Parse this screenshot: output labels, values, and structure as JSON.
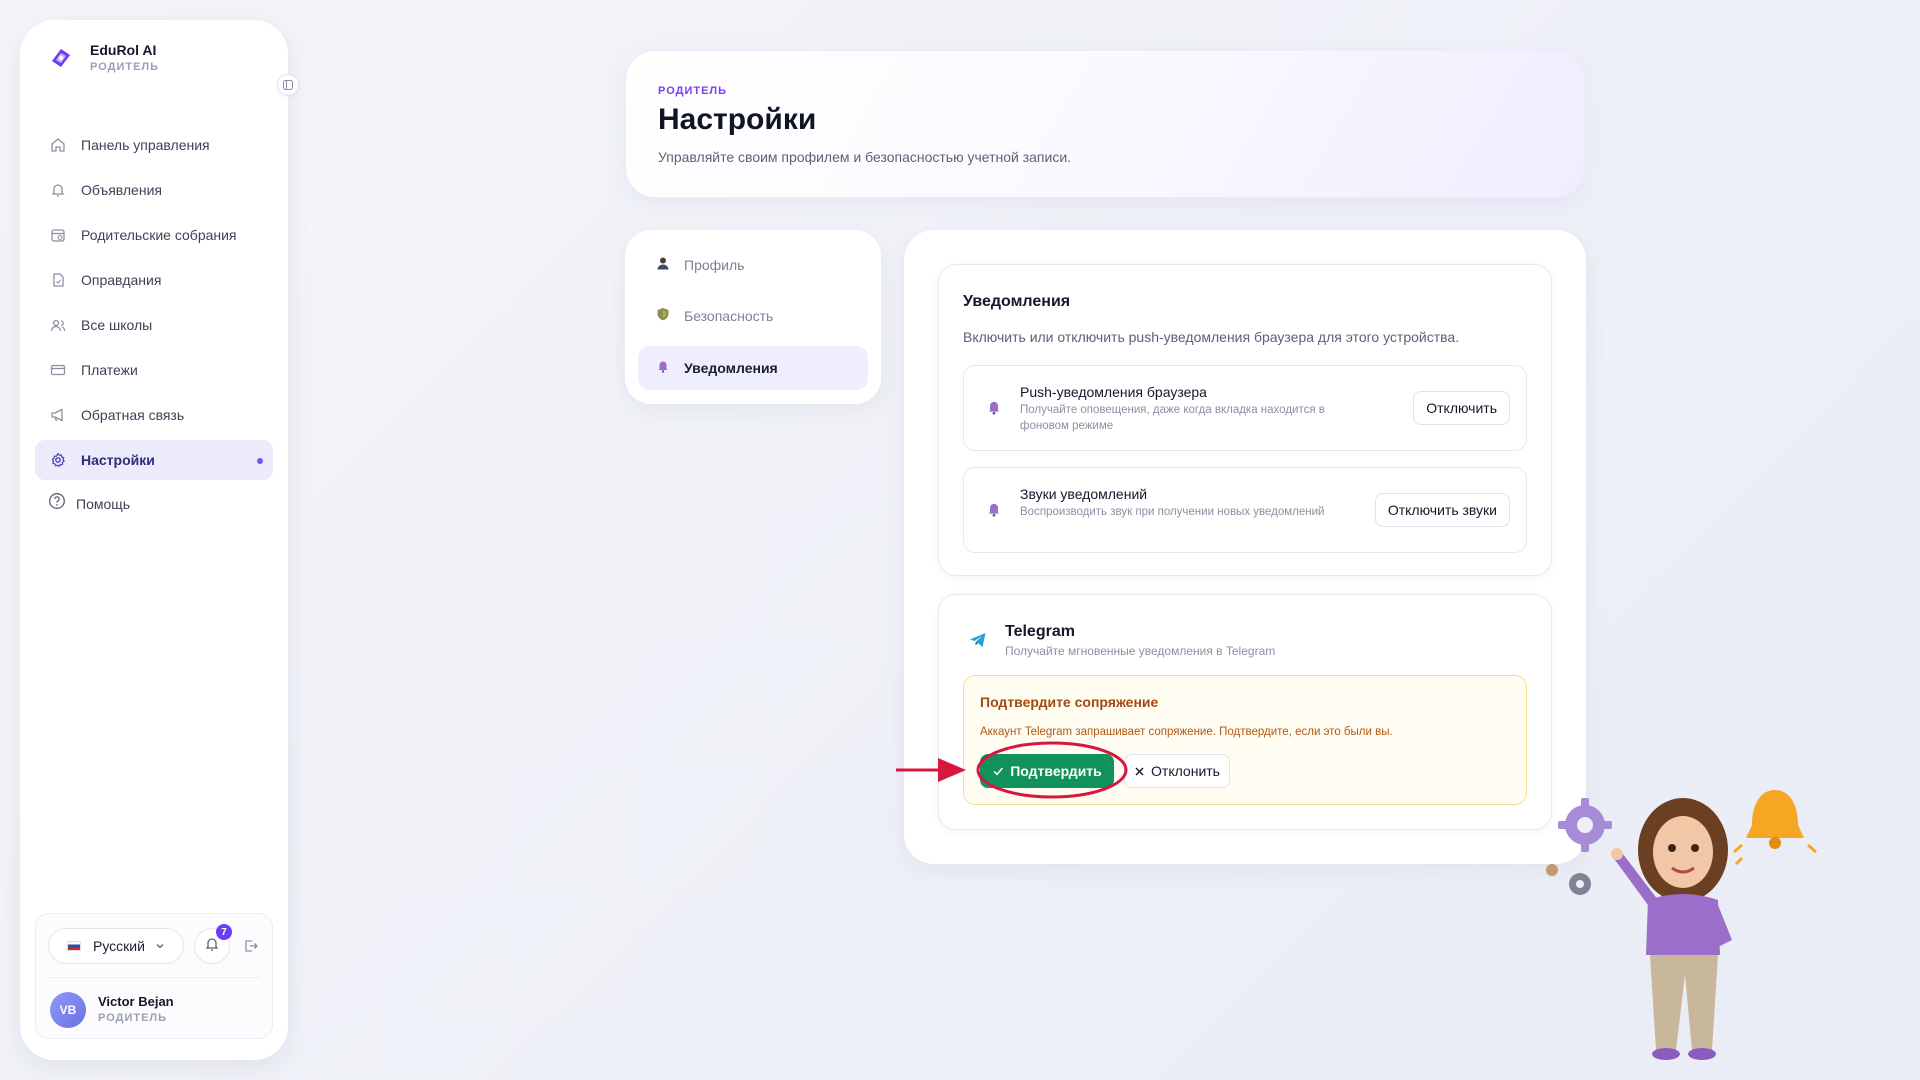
{
  "brand": {
    "name": "EduRol AI",
    "role": "РОДИТЕЛЬ"
  },
  "sidebar": {
    "items": [
      {
        "label": "Панель управления",
        "icon": "home-icon"
      },
      {
        "label": "Объявления",
        "icon": "bell-icon"
      },
      {
        "label": "Родительские собрания",
        "icon": "calendar-icon"
      },
      {
        "label": "Оправдания",
        "icon": "document-icon"
      },
      {
        "label": "Все школы",
        "icon": "users-icon"
      },
      {
        "label": "Платежи",
        "icon": "card-icon"
      },
      {
        "label": "Обратная связь",
        "icon": "megaphone-icon"
      },
      {
        "label": "Настройки",
        "icon": "gear-icon",
        "active": true
      }
    ],
    "help_label": "Помощь"
  },
  "footer": {
    "language": "Русский",
    "notification_count": "7",
    "user_initials": "VB",
    "user_name": "Victor Bejan",
    "user_role": "РОДИТЕЛЬ"
  },
  "header": {
    "kicker": "РОДИТЕЛЬ",
    "title": "Настройки",
    "subtitle": "Управляйте своим профилем и безопасностью учетной записи."
  },
  "tabs": [
    {
      "label": "Профиль",
      "icon": "person-icon"
    },
    {
      "label": "Безопасность",
      "icon": "shield-icon"
    },
    {
      "label": "Уведомления",
      "icon": "bell-icon",
      "active": true
    }
  ],
  "notifications": {
    "title": "Уведомления",
    "description": "Включить или отключить push-уведомления браузера для этого устройства.",
    "options": [
      {
        "title": "Push-уведомления браузера",
        "description": "Получайте оповещения, даже когда вкладка находится в фоновом режиме",
        "button": "Отключить"
      },
      {
        "title": "Звуки уведомлений",
        "description": "Воспроизводить звук при получении новых уведомлений",
        "button": "Отключить звуки"
      }
    ]
  },
  "telegram": {
    "title": "Telegram",
    "subtitle": "Получайте мгновенные уведомления в Telegram",
    "confirm_title": "Подтвердите сопряжение",
    "confirm_text": "Аккаунт Telegram запрашивает сопряжение. Подтвердите, если это были вы.",
    "confirm_button": "Подтвердить",
    "reject_button": "Отклонить"
  },
  "colors": {
    "accent": "#6c5ce7",
    "kicker": "#7a3df0",
    "confirm": "#11915b",
    "annotation": "#d8173f",
    "warning_bg": "#fffcf2"
  }
}
